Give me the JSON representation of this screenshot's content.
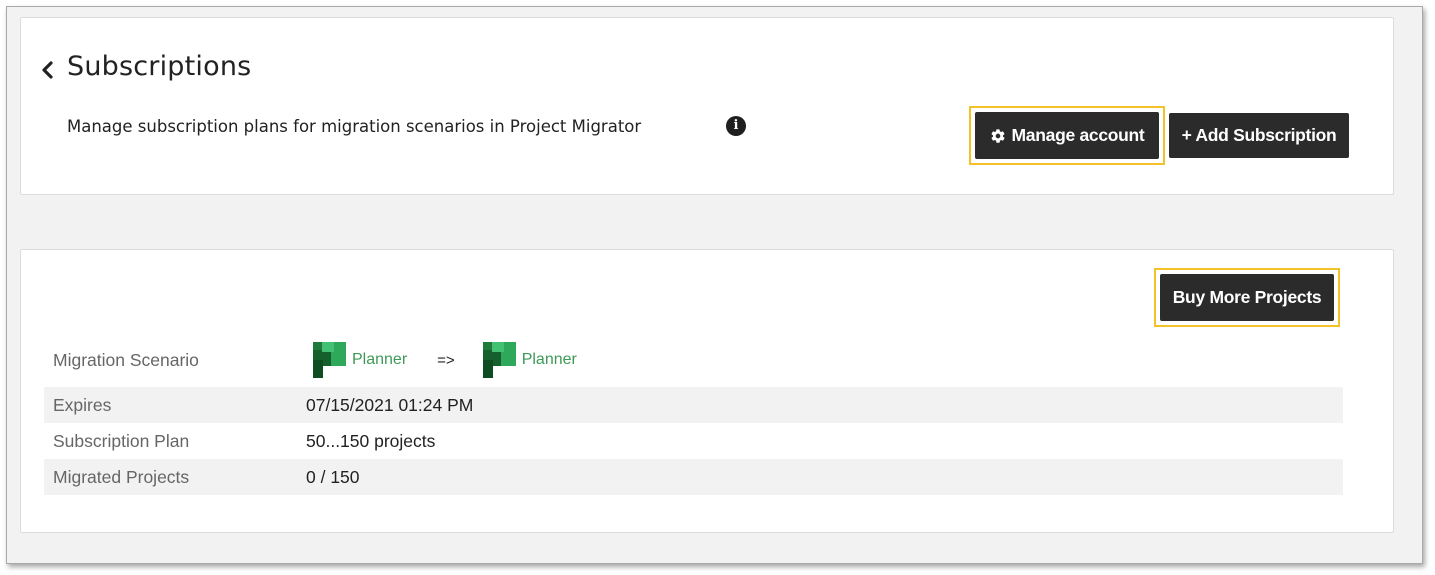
{
  "header": {
    "title": "Subscriptions",
    "subtitle": "Manage subscription plans for migration scenarios in Project Migrator",
    "manage_account_label": "Manage account",
    "add_subscription_label": "+ Add Subscription"
  },
  "subscription": {
    "buy_more_label": "Buy More Projects",
    "scenario": {
      "label": "Migration Scenario",
      "source": "Planner",
      "arrow": "=>",
      "target": "Planner"
    },
    "rows": [
      {
        "label": "Expires",
        "value": "07/15/2021 01:24 PM"
      },
      {
        "label": "Subscription Plan",
        "value": "50...150 projects"
      },
      {
        "label": "Migrated Projects",
        "value": "0 / 150"
      }
    ]
  },
  "colors": {
    "button_bg": "#2b2b2b",
    "highlight": "#f3c22b",
    "planner_text": "#3e9a57",
    "row_alt": "#f2f2f2"
  },
  "icons": [
    "chevron-left-icon",
    "info-icon",
    "gear-icon",
    "planner-logo-icon"
  ]
}
